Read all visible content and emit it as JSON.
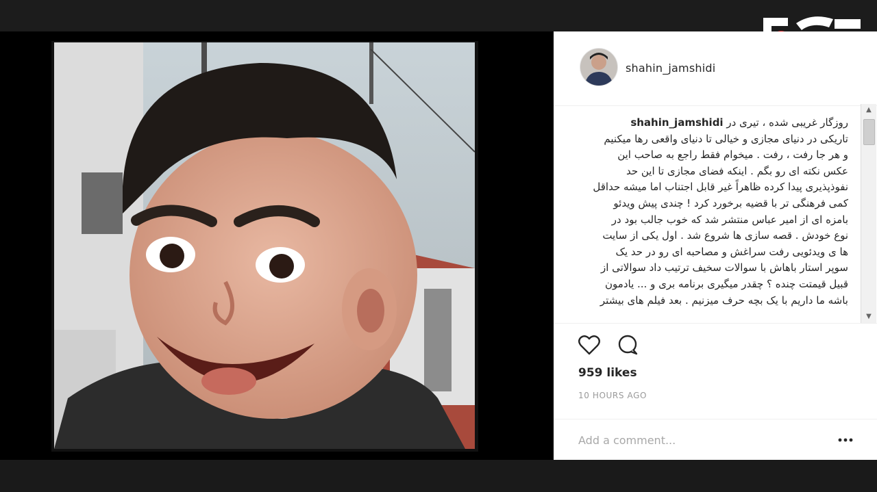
{
  "post": {
    "username": "shahin_jamshidi",
    "caption_username": "shahin_jamshidi",
    "caption_lines": [
      "روزگار غریبی شده ، تیری در",
      "تاریکی در دنیای مجازی و خیالی تا دنیای واقعی رها میکنیم",
      "و هر جا رفت ، رفت . میخوام فقط راجع به صاحب این",
      "عکس نکته ای رو بگم . اینکه فضای مجازی تا این حد",
      "نفوذپذیری پیدا کرده ظاهراً غیر قابل اجتناب اما میشه حداقل",
      "کمی فرهنگی تر با قضیه برخورد کرد ! چندی پیش ویدئو",
      "بامزه ای از امیر عباس منتشر شد که خوب جالب بود در",
      "نوع خودش . قصه سازی ها شروع شد . اول یکی از سایت",
      "ها ی ویدئویی رفت سراغش و مصاحبه ای رو در حد یک",
      "سوپر استار باهاش با سوالات سخیف ترتیب داد سوالاتی از",
      "قبیل قیمتت چنده ؟ چقدر میگیری برنامه بری و ... یادمون",
      "باشه ما داریم با یک بچه حرف میزنیم . بعد فیلم های بیشتر"
    ],
    "likes": "959 likes",
    "time_ago": "10 HOURS AGO",
    "comment_placeholder": "Add a comment..."
  },
  "icons": {
    "like": "heart-outline-icon",
    "comment": "speech-bubble-icon",
    "more": "more-options-icon",
    "scroll_up": "arrow-up-icon",
    "scroll_down": "arrow-down-icon"
  },
  "colors": {
    "text": "#262626",
    "muted": "#999999",
    "border": "#efefef",
    "logo_red": "#d7141a"
  }
}
